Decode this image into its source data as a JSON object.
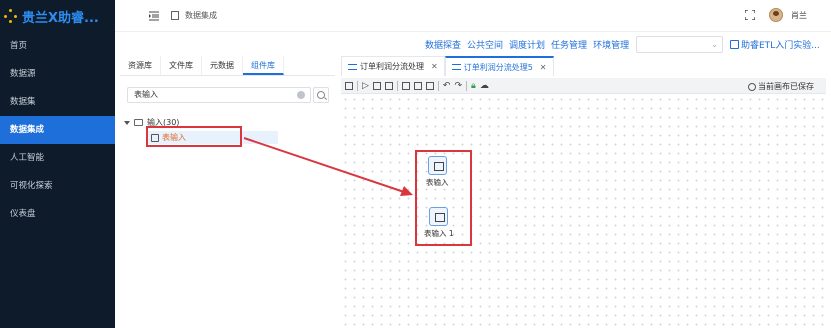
{
  "app": {
    "title": "贵兰X助睿..."
  },
  "sidebar": {
    "items": [
      {
        "label": "首页"
      },
      {
        "label": "数据源"
      },
      {
        "label": "数据集"
      },
      {
        "label": "数据集成",
        "active": true
      },
      {
        "label": "人工智能"
      },
      {
        "label": "可视化探索"
      },
      {
        "label": "仪表盘"
      }
    ]
  },
  "header": {
    "breadcrumb": "数据集成",
    "username": "肖兰"
  },
  "topmenu": {
    "items": [
      "数据探查",
      "公共空间",
      "调度计划",
      "任务管理",
      "环境管理"
    ],
    "select_value": "",
    "guide_label": "助睿ETL入门实验..."
  },
  "left_panel": {
    "tabs": [
      "资源库",
      "文件库",
      "元数据",
      "组件库"
    ],
    "active_tab": "组件库",
    "search_value": "表输入",
    "tree_root": "输入(30)",
    "tree_leaf": "表输入"
  },
  "workspace": {
    "tabs": [
      {
        "label": "订单利润分流处理",
        "active": false
      },
      {
        "label": "订单利润分流处理5",
        "active": true
      }
    ],
    "close_label": "✕",
    "save_status": "当前画布已保存",
    "nodes": [
      {
        "label": "表输入"
      },
      {
        "label": "表输入 1"
      }
    ]
  },
  "colors": {
    "sidebar_bg": "#0d1b2a",
    "accent": "#1f6fdb",
    "annotation_red": "#d9363e"
  }
}
